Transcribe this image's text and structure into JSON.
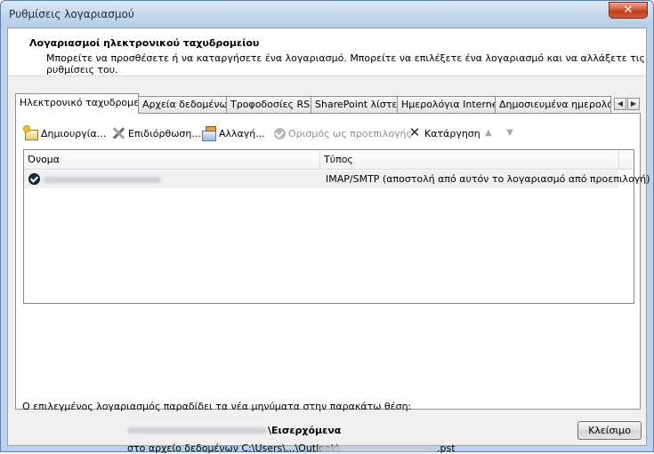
{
  "window": {
    "title": "Ρυθμίσεις λογαριασμού",
    "close_glyph": "✕"
  },
  "header": {
    "title": "Λογαριασμοί ηλεκτρονικού ταχυδρομείου",
    "subtitle": "Μπορείτε να προσθέσετε ή να καταργήσετε ένα λογαριασμό. Μπορείτε να επιλέξετε ένα λογαριασμό και να αλλάξετε τις ρυθμίσεις του."
  },
  "tabs": [
    {
      "label": "Ηλεκτρονικό ταχυδρομείο",
      "active": true
    },
    {
      "label": "Αρχεία δεδομένων",
      "active": false
    },
    {
      "label": "Τροφοδοσίες RSS",
      "active": false
    },
    {
      "label": "SharePoint λίστες",
      "active": false
    },
    {
      "label": "Ημερολόγια Internet",
      "active": false
    },
    {
      "label": "Δημοσιευμένα ημερολόγια",
      "active": false
    }
  ],
  "tab_scroll": {
    "left": "◀",
    "right": "▶"
  },
  "toolbar": {
    "new_label": "Δημιουργία...",
    "repair_label": "Επιδιόρθωση...",
    "change_label": "Αλλαγή...",
    "set_default_label": "Ορισμός ως προεπιλογής",
    "remove_label": "Κατάργηση",
    "remove_glyph": "✕",
    "move_up_glyph": "▲",
    "move_down_glyph": "▼"
  },
  "accounts_table": {
    "columns": [
      "Όνομα",
      "Τύπος"
    ],
    "rows": [
      {
        "name": "",
        "type": "IMAP/SMTP (αποστολή από αυτόν το λογαριασμό από προεπιλογή)"
      }
    ]
  },
  "delivery": {
    "label": "Ο επιλεγμένος λογαριασμός παραδίδει τα νέα μηνύματα στην παρακάτω θέση:",
    "folder": "\\Εισερχόμενα",
    "path_prefix": "στο αρχείο δεδομένων C:\\Users\\...\\Outlook\\",
    "path_suffix": ".pst"
  },
  "footer": {
    "close_label": "Κλείσιμο"
  },
  "colors": {
    "window_frame": "#bcd2ea",
    "close_button_red": "#c23b1c",
    "disabled_text": "#8d8d8d"
  }
}
